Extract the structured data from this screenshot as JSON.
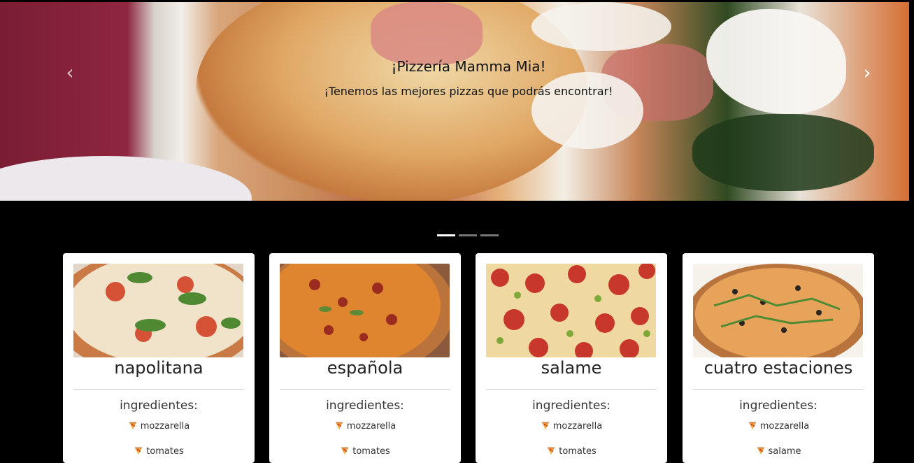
{
  "carousel": {
    "title": "¡Pizzería Mamma Mia!",
    "subtitle": "¡Tenemos las mejores pizzas que podrás encontrar!",
    "prev_icon": "chevron-left-icon",
    "next_icon": "chevron-right-icon",
    "prev_glyph": "‹",
    "next_glyph": "›",
    "slides": 3,
    "active_slide": 1
  },
  "cards": [
    {
      "name": "napolitana",
      "ingredients_label": "ingredientes:",
      "ingredients": [
        "mozzarella",
        "tomates"
      ]
    },
    {
      "name": "española",
      "ingredients_label": "ingredientes:",
      "ingredients": [
        "mozzarella",
        "tomates"
      ]
    },
    {
      "name": "salame",
      "ingredients_label": "ingredientes:",
      "ingredients": [
        "mozzarella",
        "tomates"
      ]
    },
    {
      "name": "cuatro estaciones",
      "ingredients_label": "ingredientes:",
      "ingredients": [
        "mozzarella",
        "salame"
      ]
    }
  ],
  "colors": {
    "background": "#000000",
    "card": "#ffffff",
    "indicator_active": "#ffffff",
    "indicator_inactive": "#777777"
  }
}
